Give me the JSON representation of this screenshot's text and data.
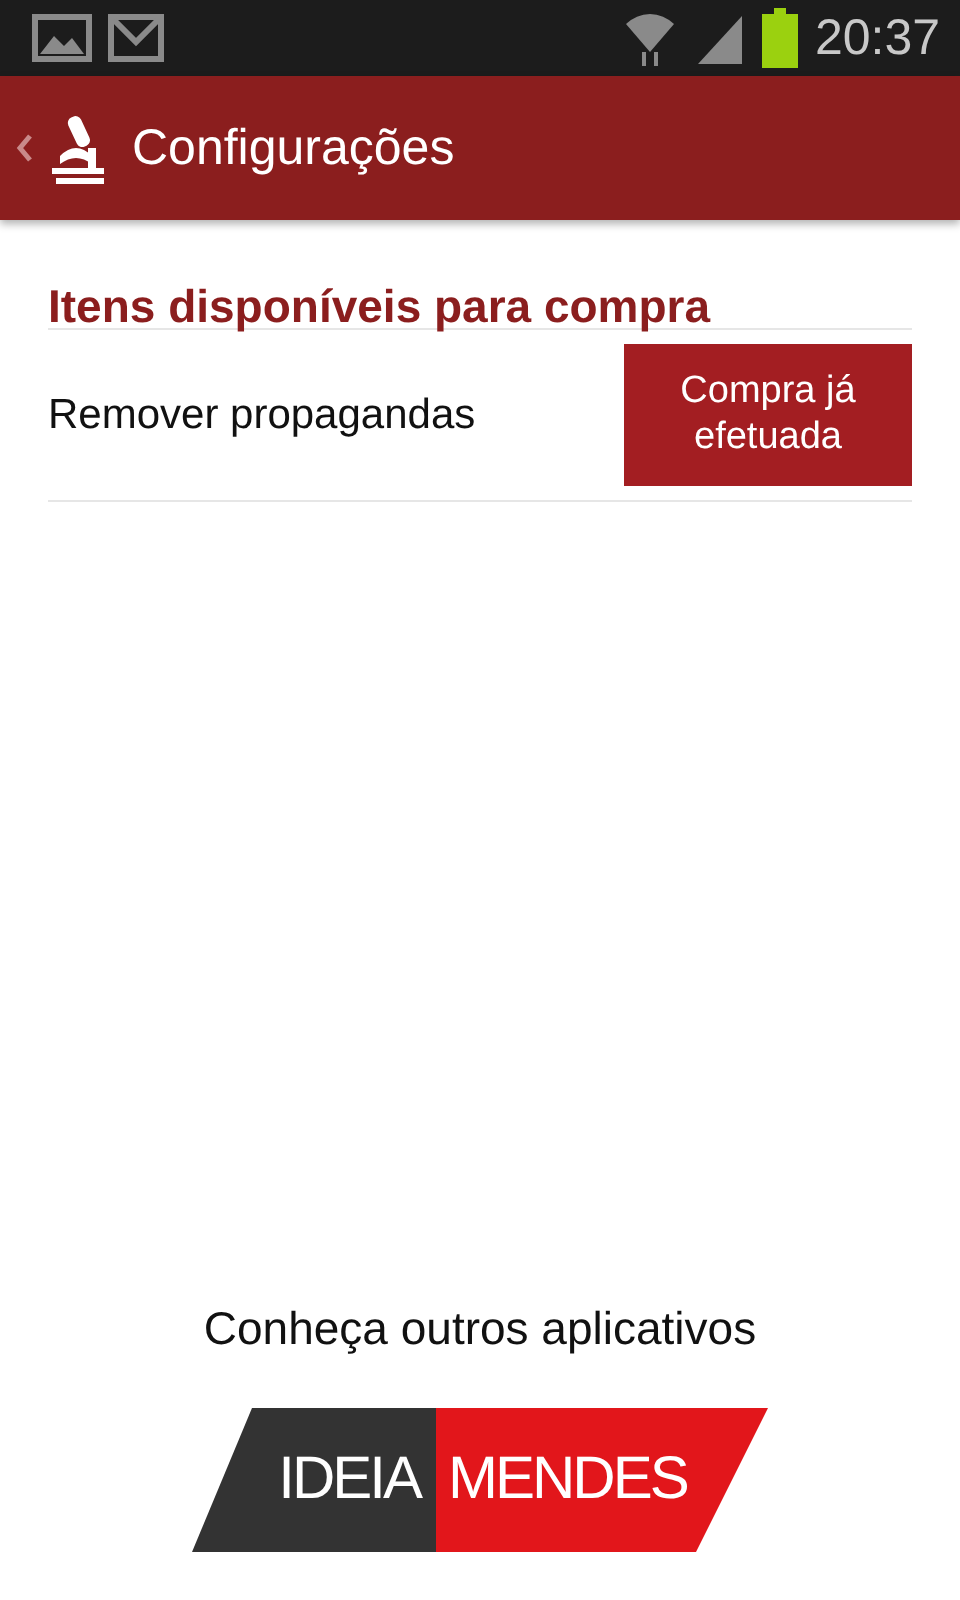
{
  "status_bar": {
    "time": "20:37"
  },
  "app_bar": {
    "title": "Configurações"
  },
  "section": {
    "title": "Itens disponíveis para compra",
    "items": [
      {
        "label": "Remover propagandas",
        "button": "Compra já efetuada"
      }
    ]
  },
  "footer": {
    "text": "Conheça outros aplicativos",
    "logo": [
      "IDEIA",
      "MENDES"
    ]
  }
}
